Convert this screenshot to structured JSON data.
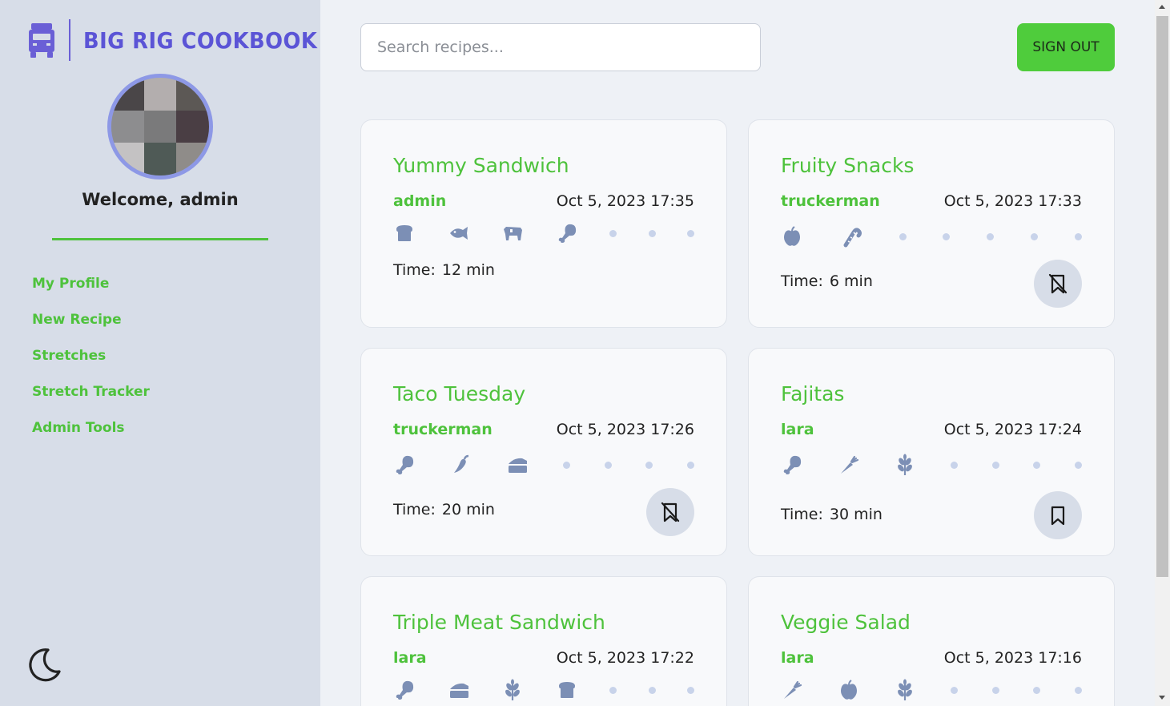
{
  "app": {
    "title": "BIG RIG COOKBOOK",
    "brand_color": "#5b54d6",
    "accent_color": "#4ec23c"
  },
  "sidebar": {
    "welcome": "Welcome, admin",
    "nav": [
      {
        "label": "My Profile"
      },
      {
        "label": "New Recipe"
      },
      {
        "label": "Stretches"
      },
      {
        "label": "Stretch Tracker"
      },
      {
        "label": "Admin Tools"
      }
    ],
    "theme_toggle_icon": "moon-icon"
  },
  "header": {
    "search_placeholder": "Search recipes...",
    "signout_label": "SIGN OUT"
  },
  "time_label": "Time:",
  "recipes": [
    {
      "title": "Yummy Sandwich",
      "author": "admin",
      "date": "Oct 5, 2023 17:35",
      "time": "12 min",
      "ingredients": [
        "bread-icon",
        "fish-icon",
        "cow-icon",
        "drumstick-icon"
      ],
      "bookmark": "none"
    },
    {
      "title": "Fruity Snacks",
      "author": "truckerman",
      "date": "Oct 5, 2023 17:33",
      "time": "6 min",
      "ingredients": [
        "apple-icon",
        "candy-cane-icon"
      ],
      "bookmark": "bookmark-slash-icon"
    },
    {
      "title": "Taco Tuesday",
      "author": "truckerman",
      "date": "Oct 5, 2023 17:26",
      "time": "20 min",
      "ingredients": [
        "drumstick-icon",
        "pepper-icon",
        "cheese-icon"
      ],
      "bookmark": "bookmark-slash-icon"
    },
    {
      "title": "Fajitas",
      "author": "lara",
      "date": "Oct 5, 2023 17:24",
      "time": "30 min",
      "ingredients": [
        "drumstick-icon",
        "carrot-icon",
        "wheat-icon"
      ],
      "bookmark": "bookmark-icon"
    },
    {
      "title": "Triple Meat Sandwich",
      "author": "lara",
      "date": "Oct 5, 2023 17:22",
      "time": "",
      "ingredients": [
        "drumstick-icon",
        "cheese-icon",
        "wheat-icon",
        "bread-icon"
      ],
      "bookmark": "none"
    },
    {
      "title": "Veggie Salad",
      "author": "lara",
      "date": "Oct 5, 2023 17:16",
      "time": "",
      "ingredients": [
        "carrot-icon",
        "apple-icon",
        "wheat-icon"
      ],
      "bookmark": "none"
    }
  ]
}
